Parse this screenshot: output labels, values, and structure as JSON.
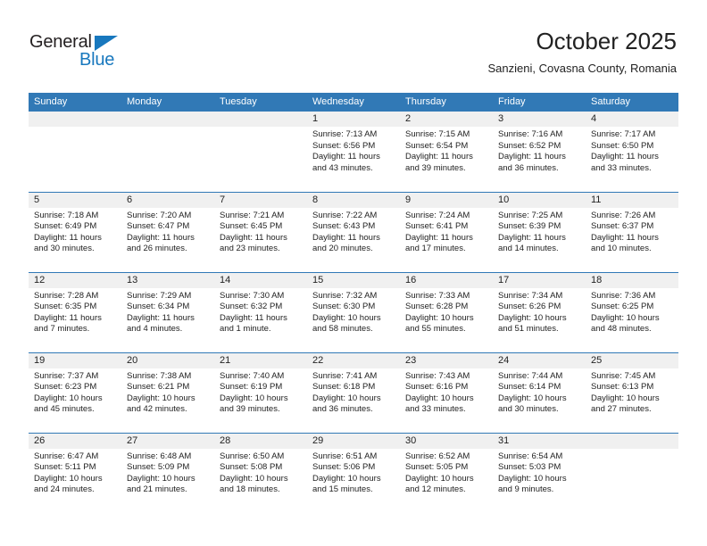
{
  "brand": {
    "name_part1": "General",
    "name_part2": "Blue",
    "accent_color": "#1878be"
  },
  "header": {
    "title": "October 2025",
    "subtitle": "Sanzieni, Covasna County, Romania"
  },
  "theme": {
    "header_bar_color": "#3179b6",
    "daynum_band_color": "#f0f0f0",
    "row_divider_color": "#3179b6"
  },
  "weekday_headers": [
    "Sunday",
    "Monday",
    "Tuesday",
    "Wednesday",
    "Thursday",
    "Friday",
    "Saturday"
  ],
  "weeks": [
    [
      {
        "day": "",
        "lines": []
      },
      {
        "day": "",
        "lines": []
      },
      {
        "day": "",
        "lines": []
      },
      {
        "day": "1",
        "lines": [
          "Sunrise: 7:13 AM",
          "Sunset: 6:56 PM",
          "Daylight: 11 hours",
          "and 43 minutes."
        ]
      },
      {
        "day": "2",
        "lines": [
          "Sunrise: 7:15 AM",
          "Sunset: 6:54 PM",
          "Daylight: 11 hours",
          "and 39 minutes."
        ]
      },
      {
        "day": "3",
        "lines": [
          "Sunrise: 7:16 AM",
          "Sunset: 6:52 PM",
          "Daylight: 11 hours",
          "and 36 minutes."
        ]
      },
      {
        "day": "4",
        "lines": [
          "Sunrise: 7:17 AM",
          "Sunset: 6:50 PM",
          "Daylight: 11 hours",
          "and 33 minutes."
        ]
      }
    ],
    [
      {
        "day": "5",
        "lines": [
          "Sunrise: 7:18 AM",
          "Sunset: 6:49 PM",
          "Daylight: 11 hours",
          "and 30 minutes."
        ]
      },
      {
        "day": "6",
        "lines": [
          "Sunrise: 7:20 AM",
          "Sunset: 6:47 PM",
          "Daylight: 11 hours",
          "and 26 minutes."
        ]
      },
      {
        "day": "7",
        "lines": [
          "Sunrise: 7:21 AM",
          "Sunset: 6:45 PM",
          "Daylight: 11 hours",
          "and 23 minutes."
        ]
      },
      {
        "day": "8",
        "lines": [
          "Sunrise: 7:22 AM",
          "Sunset: 6:43 PM",
          "Daylight: 11 hours",
          "and 20 minutes."
        ]
      },
      {
        "day": "9",
        "lines": [
          "Sunrise: 7:24 AM",
          "Sunset: 6:41 PM",
          "Daylight: 11 hours",
          "and 17 minutes."
        ]
      },
      {
        "day": "10",
        "lines": [
          "Sunrise: 7:25 AM",
          "Sunset: 6:39 PM",
          "Daylight: 11 hours",
          "and 14 minutes."
        ]
      },
      {
        "day": "11",
        "lines": [
          "Sunrise: 7:26 AM",
          "Sunset: 6:37 PM",
          "Daylight: 11 hours",
          "and 10 minutes."
        ]
      }
    ],
    [
      {
        "day": "12",
        "lines": [
          "Sunrise: 7:28 AM",
          "Sunset: 6:35 PM",
          "Daylight: 11 hours",
          "and 7 minutes."
        ]
      },
      {
        "day": "13",
        "lines": [
          "Sunrise: 7:29 AM",
          "Sunset: 6:34 PM",
          "Daylight: 11 hours",
          "and 4 minutes."
        ]
      },
      {
        "day": "14",
        "lines": [
          "Sunrise: 7:30 AM",
          "Sunset: 6:32 PM",
          "Daylight: 11 hours",
          "and 1 minute."
        ]
      },
      {
        "day": "15",
        "lines": [
          "Sunrise: 7:32 AM",
          "Sunset: 6:30 PM",
          "Daylight: 10 hours",
          "and 58 minutes."
        ]
      },
      {
        "day": "16",
        "lines": [
          "Sunrise: 7:33 AM",
          "Sunset: 6:28 PM",
          "Daylight: 10 hours",
          "and 55 minutes."
        ]
      },
      {
        "day": "17",
        "lines": [
          "Sunrise: 7:34 AM",
          "Sunset: 6:26 PM",
          "Daylight: 10 hours",
          "and 51 minutes."
        ]
      },
      {
        "day": "18",
        "lines": [
          "Sunrise: 7:36 AM",
          "Sunset: 6:25 PM",
          "Daylight: 10 hours",
          "and 48 minutes."
        ]
      }
    ],
    [
      {
        "day": "19",
        "lines": [
          "Sunrise: 7:37 AM",
          "Sunset: 6:23 PM",
          "Daylight: 10 hours",
          "and 45 minutes."
        ]
      },
      {
        "day": "20",
        "lines": [
          "Sunrise: 7:38 AM",
          "Sunset: 6:21 PM",
          "Daylight: 10 hours",
          "and 42 minutes."
        ]
      },
      {
        "day": "21",
        "lines": [
          "Sunrise: 7:40 AM",
          "Sunset: 6:19 PM",
          "Daylight: 10 hours",
          "and 39 minutes."
        ]
      },
      {
        "day": "22",
        "lines": [
          "Sunrise: 7:41 AM",
          "Sunset: 6:18 PM",
          "Daylight: 10 hours",
          "and 36 minutes."
        ]
      },
      {
        "day": "23",
        "lines": [
          "Sunrise: 7:43 AM",
          "Sunset: 6:16 PM",
          "Daylight: 10 hours",
          "and 33 minutes."
        ]
      },
      {
        "day": "24",
        "lines": [
          "Sunrise: 7:44 AM",
          "Sunset: 6:14 PM",
          "Daylight: 10 hours",
          "and 30 minutes."
        ]
      },
      {
        "day": "25",
        "lines": [
          "Sunrise: 7:45 AM",
          "Sunset: 6:13 PM",
          "Daylight: 10 hours",
          "and 27 minutes."
        ]
      }
    ],
    [
      {
        "day": "26",
        "lines": [
          "Sunrise: 6:47 AM",
          "Sunset: 5:11 PM",
          "Daylight: 10 hours",
          "and 24 minutes."
        ]
      },
      {
        "day": "27",
        "lines": [
          "Sunrise: 6:48 AM",
          "Sunset: 5:09 PM",
          "Daylight: 10 hours",
          "and 21 minutes."
        ]
      },
      {
        "day": "28",
        "lines": [
          "Sunrise: 6:50 AM",
          "Sunset: 5:08 PM",
          "Daylight: 10 hours",
          "and 18 minutes."
        ]
      },
      {
        "day": "29",
        "lines": [
          "Sunrise: 6:51 AM",
          "Sunset: 5:06 PM",
          "Daylight: 10 hours",
          "and 15 minutes."
        ]
      },
      {
        "day": "30",
        "lines": [
          "Sunrise: 6:52 AM",
          "Sunset: 5:05 PM",
          "Daylight: 10 hours",
          "and 12 minutes."
        ]
      },
      {
        "day": "31",
        "lines": [
          "Sunrise: 6:54 AM",
          "Sunset: 5:03 PM",
          "Daylight: 10 hours",
          "and 9 minutes."
        ]
      },
      {
        "day": "",
        "lines": []
      }
    ]
  ]
}
